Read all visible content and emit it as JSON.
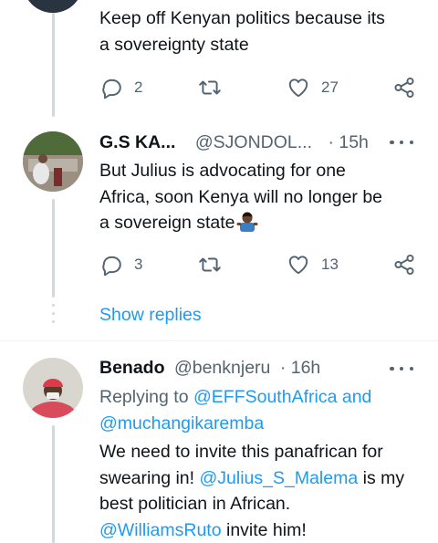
{
  "tweet1": {
    "text_lines": [
      "Keep off Kenyan politics because its",
      "a sovereignty state"
    ],
    "replies": "2",
    "likes": "27"
  },
  "tweet2": {
    "name": "G.S KA...",
    "handle": "@SJONDOL...",
    "time": "· 15h",
    "text_lines": [
      "But Julius is advocating for one",
      "Africa, soon Kenya will no longer be",
      "a sovereign state"
    ],
    "emoji": "person-shrugging-emoji",
    "replies": "3",
    "likes": "13"
  },
  "show_replies": "Show replies",
  "tweet3": {
    "name": "Benado",
    "handle": "@benknjeru",
    "time": "· 16h",
    "replying_prefix": "Replying to",
    "replying_to_1": "@EFFSouthAfrica",
    "replying_and": "and",
    "replying_to_2": "@muchangikaremba",
    "line1": "We need to invite this panafrican for",
    "line2_a": "swearing in!",
    "mention_1": "@Julius_S_Malema",
    "line2_b": "is my",
    "line3": "best politician in African.",
    "mention_2": "@WilliamsRuto",
    "line4_b": "invite him!"
  },
  "colors": {
    "link": "#1d9bf0",
    "muted": "#536471",
    "text": "#0f1419",
    "thread": "#cfd9de"
  },
  "icons": [
    "reply-icon",
    "retweet-icon",
    "like-icon",
    "share-icon",
    "more-icon"
  ]
}
